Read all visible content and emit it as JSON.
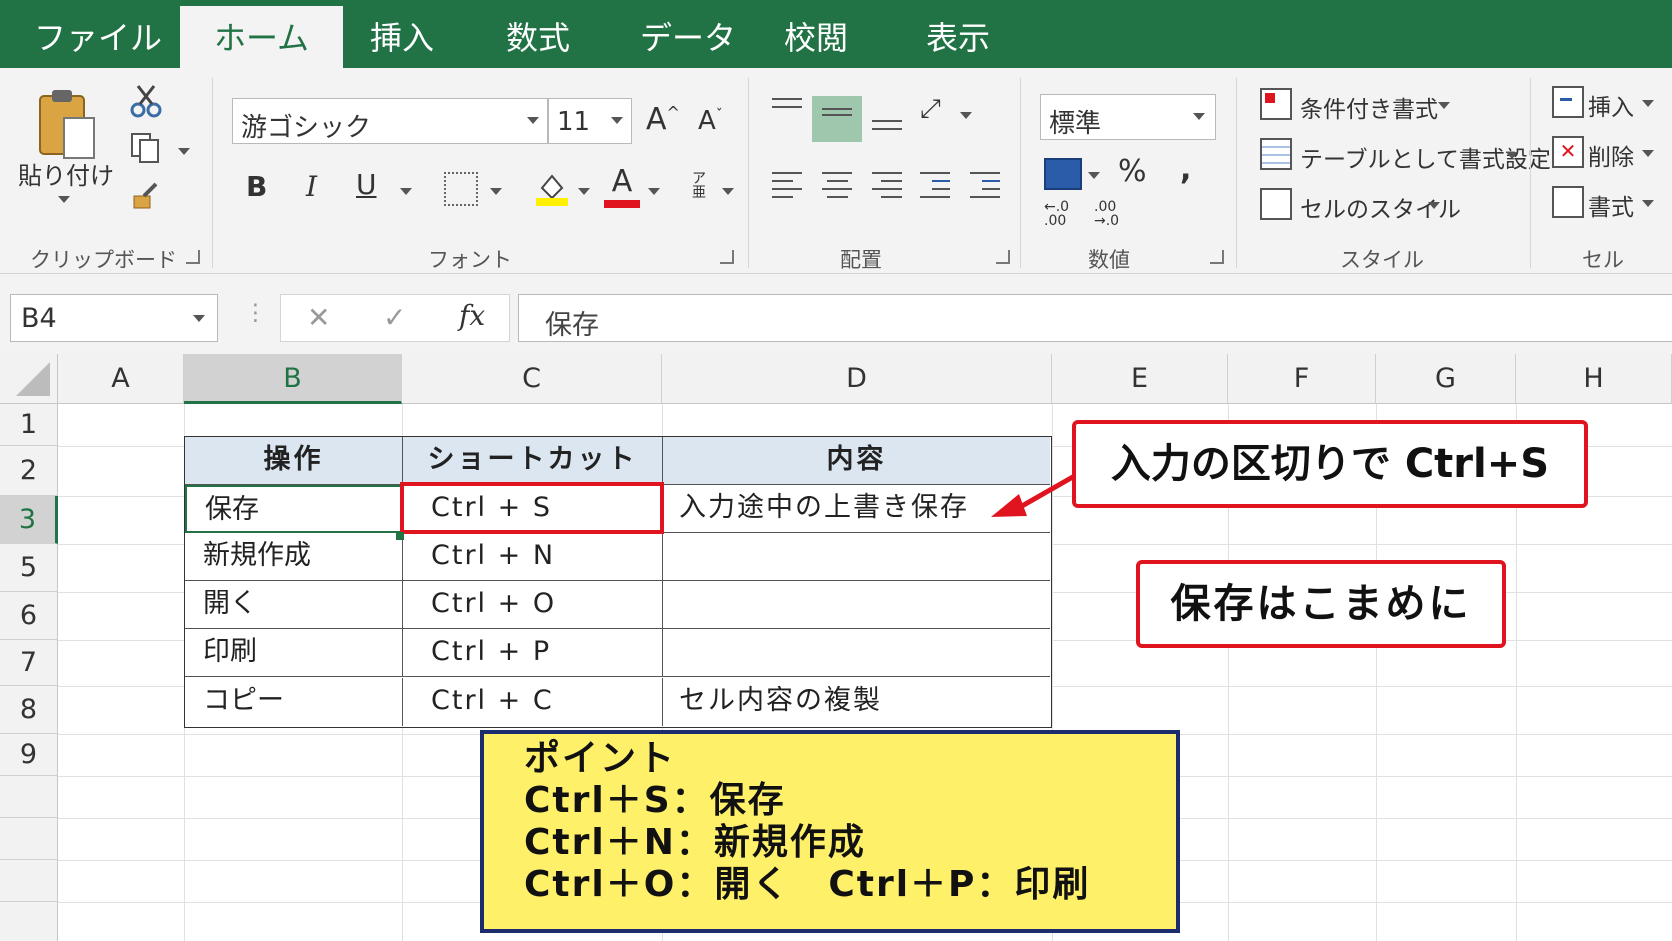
{
  "tabs": [
    "ファイル",
    "ホーム",
    "挿入",
    "数式",
    "データ",
    "校閲",
    "表示"
  ],
  "active_tab": "ホーム",
  "ribbon": {
    "clipboard": {
      "paste_label": "貼り付け",
      "group_label": "クリップボード"
    },
    "font": {
      "font_name": "游ゴシック",
      "font_size": "11",
      "bold": "B",
      "italic": "I",
      "underline": "U",
      "grow": "A",
      "shrink": "A",
      "font_color_letter": "A",
      "phonetic": "ア亜",
      "group_label": "フォント"
    },
    "alignment": {
      "group_label": "配置"
    },
    "number": {
      "format": "標準",
      "percent": "%",
      "comma": ",",
      "inc_decimal": "←.0 .00",
      "dec_decimal": ".00 →.0",
      "group_label": "数値"
    },
    "styles": {
      "conditional": "条件付き書式",
      "table": "テーブルとして書式設定",
      "cell_styles": "セルのスタイル",
      "group_label": "スタイル"
    },
    "cells": {
      "insert": "挿入",
      "delete": "削除",
      "format": "書式",
      "group_label": "セル"
    }
  },
  "formula_bar": {
    "name_box": "B4",
    "cancel": "✕",
    "enter": "✓",
    "fx": "fx",
    "content": "保存"
  },
  "columns": [
    "A",
    "B",
    "C",
    "D",
    "E",
    "F",
    "G",
    "H"
  ],
  "rows": [
    "1",
    "2",
    "3",
    "5",
    "6",
    "7",
    "8",
    "9"
  ],
  "table": {
    "headers": [
      "操作",
      "ショートカット",
      "内容"
    ],
    "rows": [
      [
        "保存",
        "Ctrl + S",
        "入力途中の上書き保存"
      ],
      [
        "新規作成",
        "Ctrl + N",
        ""
      ],
      [
        "開く",
        "Ctrl + O",
        ""
      ],
      [
        "印刷",
        "Ctrl + P",
        ""
      ],
      [
        "コピー",
        "Ctrl + C",
        "セル内容の複製"
      ]
    ]
  },
  "annotations": {
    "callout1": "入力の区切りで Ctrl+S",
    "callout2": "保存はこまめに",
    "point_title": "ポイント",
    "point_lines": [
      "Ctrl＋S：保存",
      "Ctrl＋N：新規作成",
      "Ctrl＋O：開く　Ctrl＋P：印刷"
    ]
  },
  "colors": {
    "excel_green": "#217346",
    "callout_red": "#e0141e",
    "point_yellow": "#fff06a",
    "header_blue": "#dce6f1"
  }
}
